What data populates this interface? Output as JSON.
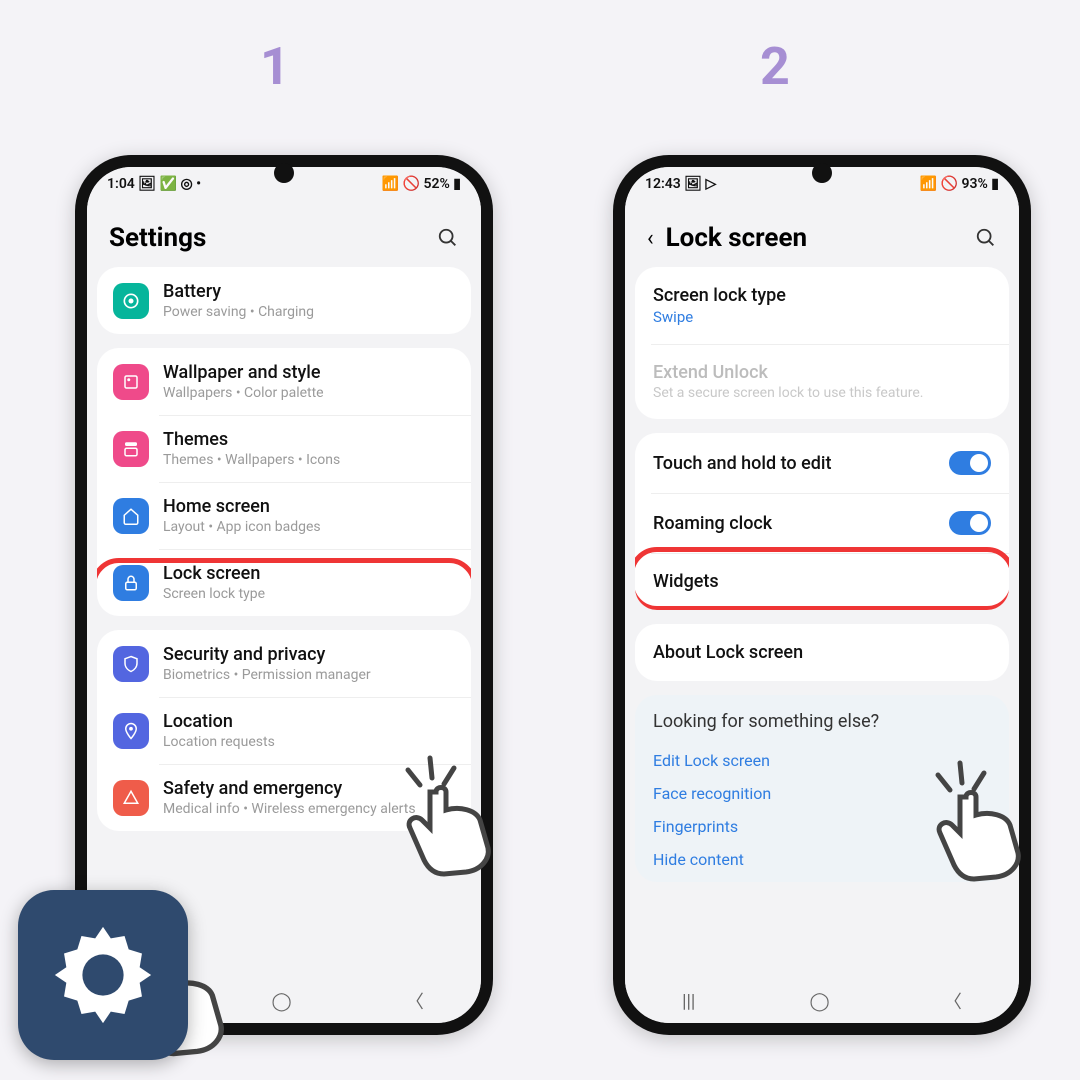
{
  "steps": {
    "1": "1",
    "2": "2"
  },
  "p1": {
    "status": {
      "time": "1:04",
      "icons": "🖼 ✅ ◎ •",
      "right": "📶 🚫 52% ▮"
    },
    "title": "Settings",
    "groups": [
      [
        {
          "icon": "battery",
          "color": "#06b59b",
          "title": "Battery",
          "sub": "Power saving  •  Charging"
        }
      ],
      [
        {
          "icon": "wallpaper",
          "color": "#ef4a8a",
          "title": "Wallpaper and style",
          "sub": "Wallpapers  •  Color palette"
        },
        {
          "icon": "themes",
          "color": "#ef4a8a",
          "title": "Themes",
          "sub": "Themes  •  Wallpapers  •  Icons"
        },
        {
          "icon": "home",
          "color": "#2f7de1",
          "title": "Home screen",
          "sub": "Layout  •  App icon badges"
        },
        {
          "icon": "lock",
          "color": "#2f7de1",
          "title": "Lock screen",
          "sub": "Screen lock type",
          "highlight": true
        }
      ],
      [
        {
          "icon": "shield",
          "color": "#5366e0",
          "title": "Security and privacy",
          "sub": "Biometrics  •  Permission manager"
        },
        {
          "icon": "location",
          "color": "#5366e0",
          "title": "Location",
          "sub": "Location requests"
        },
        {
          "icon": "safety",
          "color": "#ef5c4a",
          "title": "Safety and emergency",
          "sub": "Medical info  •  Wireless emergency alerts"
        }
      ]
    ]
  },
  "p2": {
    "status": {
      "time": "12:43",
      "icons": "🖼 ▷",
      "right": "📶 🚫 93% ▮"
    },
    "title": "Lock screen",
    "sec1": {
      "lock_type_title": "Screen lock type",
      "lock_type_val": "Swipe",
      "ext_title": "Extend Unlock",
      "ext_sub": "Set a secure screen lock to use this feature."
    },
    "sec2": {
      "touch": "Touch and hold to edit",
      "roaming": "Roaming clock",
      "widgets": "Widgets"
    },
    "about": "About Lock screen",
    "info": {
      "hd": "Looking for something else?",
      "links": [
        "Edit Lock screen",
        "Face recognition",
        "Fingerprints",
        "Hide content"
      ]
    }
  }
}
